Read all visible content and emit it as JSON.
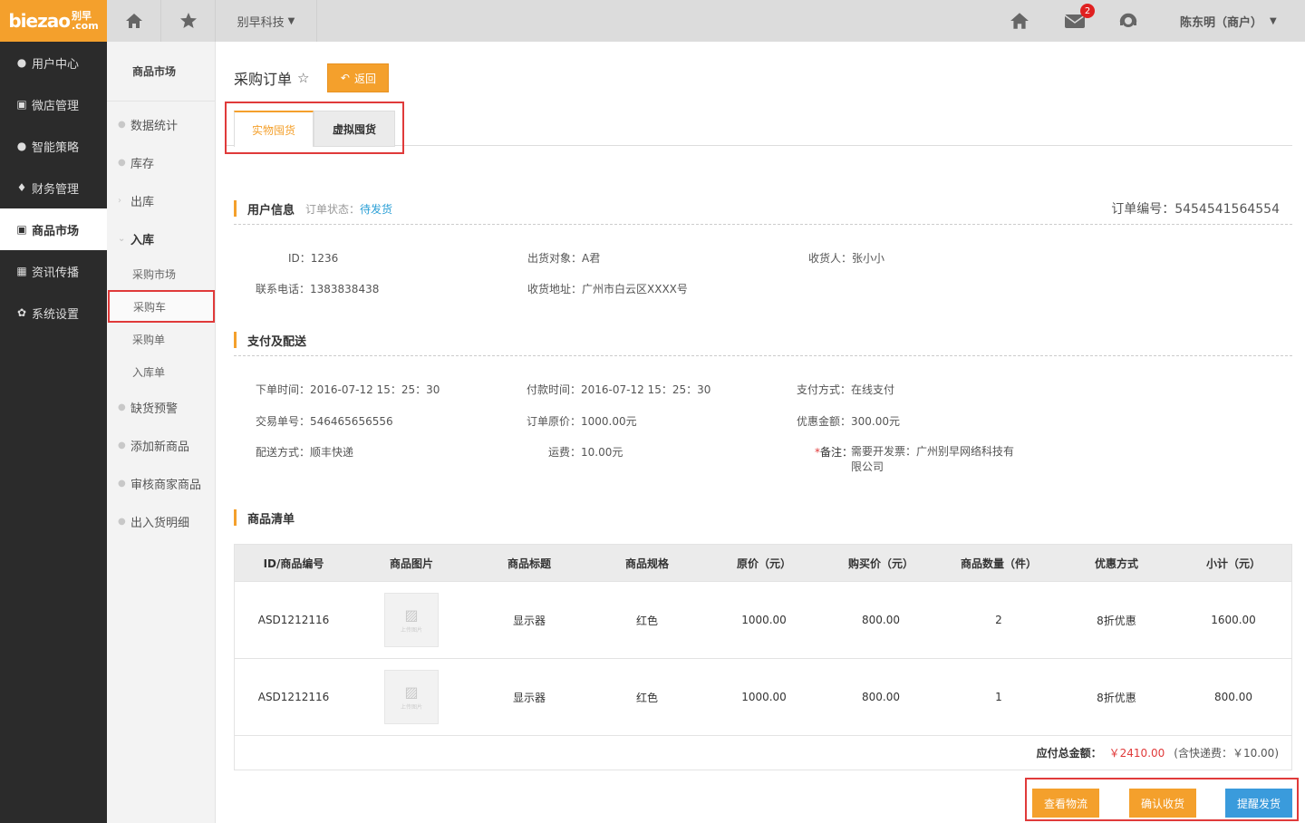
{
  "topbar": {
    "logo_main": "biezao",
    "logo_cn": "别早",
    "logo_com": ".com",
    "company": "别早科技",
    "mail_count": "2",
    "user": "陈东明（商户）"
  },
  "nav": {
    "items": [
      {
        "label": "用户中心",
        "icon": "user-icon"
      },
      {
        "label": "微店管理",
        "icon": "shop-icon"
      },
      {
        "label": "智能策略",
        "icon": "strategy-icon"
      },
      {
        "label": "财务管理",
        "icon": "finance-icon"
      },
      {
        "label": "商品市场",
        "icon": "market-icon"
      },
      {
        "label": "资讯传播",
        "icon": "grid-icon"
      },
      {
        "label": "系统设置",
        "icon": "gear-icon"
      }
    ],
    "active": "商品市场"
  },
  "subnav": {
    "title": "商品市场",
    "items": [
      "数据统计",
      "库存",
      "出库",
      "入库"
    ],
    "children": [
      "采购市场",
      "采购车",
      "采购单",
      "入库单"
    ],
    "items_after": [
      "缺货预警",
      "添加新商品",
      "审核商家商品",
      "出入货明细"
    ]
  },
  "page": {
    "title": "采购订单",
    "back_label": "返回",
    "tabs": [
      "实物囤货",
      "虚拟囤货"
    ]
  },
  "user_info": {
    "title": "用户信息",
    "status_label": "订单状态：",
    "status_value": "待发货",
    "order_no": "订单编号：5454541564554",
    "id": "ID：1236",
    "target": "出货对象：A君",
    "receiver": "收货人：张小小",
    "phone": "联系电话：1383838438",
    "address": "收货地址：广州市白云区XXXX号"
  },
  "payment": {
    "title": "支付及配送",
    "order_time": "下单时间：2016-07-12 15：25：30",
    "pay_time": "付款时间：2016-07-12 15：25：30",
    "pay_method": "支付方式：在线支付",
    "trade_no": "交易单号：546465656556",
    "order_price": "订单原价：1000.00元",
    "discount": "优惠金额：300.00元",
    "delivery": "配送方式：顺丰快递",
    "freight": "运费：10.00元",
    "remark_star": "*",
    "remark_key": "备注：",
    "remark_line1": "需要开发票：广州别早网络科技有",
    "remark_line2": "限公司"
  },
  "goods": {
    "title": "商品清单",
    "headers": [
      "ID/商品编号",
      "商品图片",
      "商品标题",
      "商品规格",
      "原价（元）",
      "购买价（元）",
      "商品数量（件）",
      "优惠方式",
      "小计（元）"
    ],
    "rows": [
      {
        "id": "ASD1212116",
        "img_text": "上传图片",
        "name": "显示器",
        "spec": "红色",
        "price": "1000.00",
        "buy": "800.00",
        "qty": "2",
        "promo": "8折优惠",
        "subtotal": "1600.00"
      },
      {
        "id": "ASD1212116",
        "img_text": "上传图片",
        "name": "显示器",
        "spec": "红色",
        "price": "1000.00",
        "buy": "800.00",
        "qty": "1",
        "promo": "8折优惠",
        "subtotal": "800.00"
      }
    ],
    "total_label": "应付总金额：",
    "total": "￥2410.00",
    "shipping_note": "(含快递费：￥10.00)"
  },
  "actions": [
    "查看物流",
    "确认收货",
    "提醒发货"
  ],
  "colors": {
    "accent": "#f4a02c",
    "highlight": "#e03a3a",
    "link": "#2a9fd6",
    "blue_button": "#3a9bdc"
  }
}
